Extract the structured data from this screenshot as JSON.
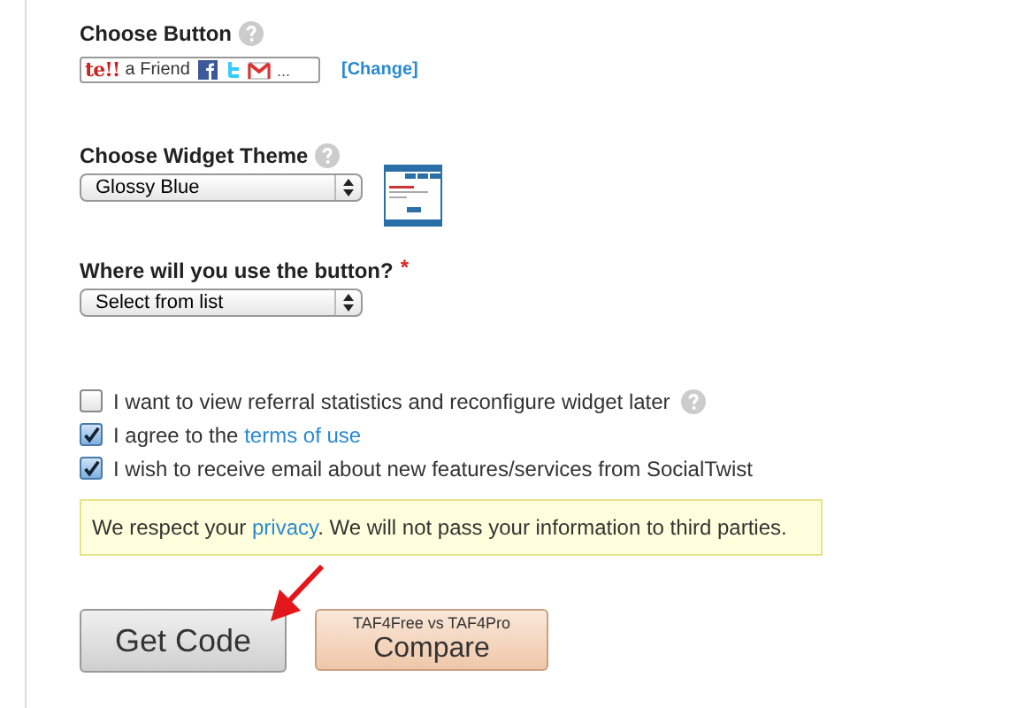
{
  "choose_button": {
    "label": "Choose Button",
    "preview": {
      "logo": "te!!",
      "text": "a Friend",
      "more": "..."
    },
    "change_link": "[Change]"
  },
  "widget_theme": {
    "label": "Choose Widget Theme",
    "value": "Glossy Blue"
  },
  "usage": {
    "label": "Where will you use the button?",
    "required_mark": "*",
    "value": "Select from list"
  },
  "options": [
    {
      "kind": "help",
      "text": "I want to view referral statistics and reconfigure widget later",
      "checked": false
    },
    {
      "kind": "link",
      "text": "I agree to the ",
      "link": "terms of use",
      "checked": true
    },
    {
      "kind": "plain",
      "text": "I wish to receive email about new features/services from SocialTwist",
      "checked": true
    }
  ],
  "notice": {
    "before": "We respect your ",
    "link": "privacy",
    "after": ". We will not pass your information to third parties."
  },
  "get_code_button": "Get Code",
  "compare_button": {
    "caption": "TAF4Free vs TAF4Pro",
    "label": "Compare"
  }
}
